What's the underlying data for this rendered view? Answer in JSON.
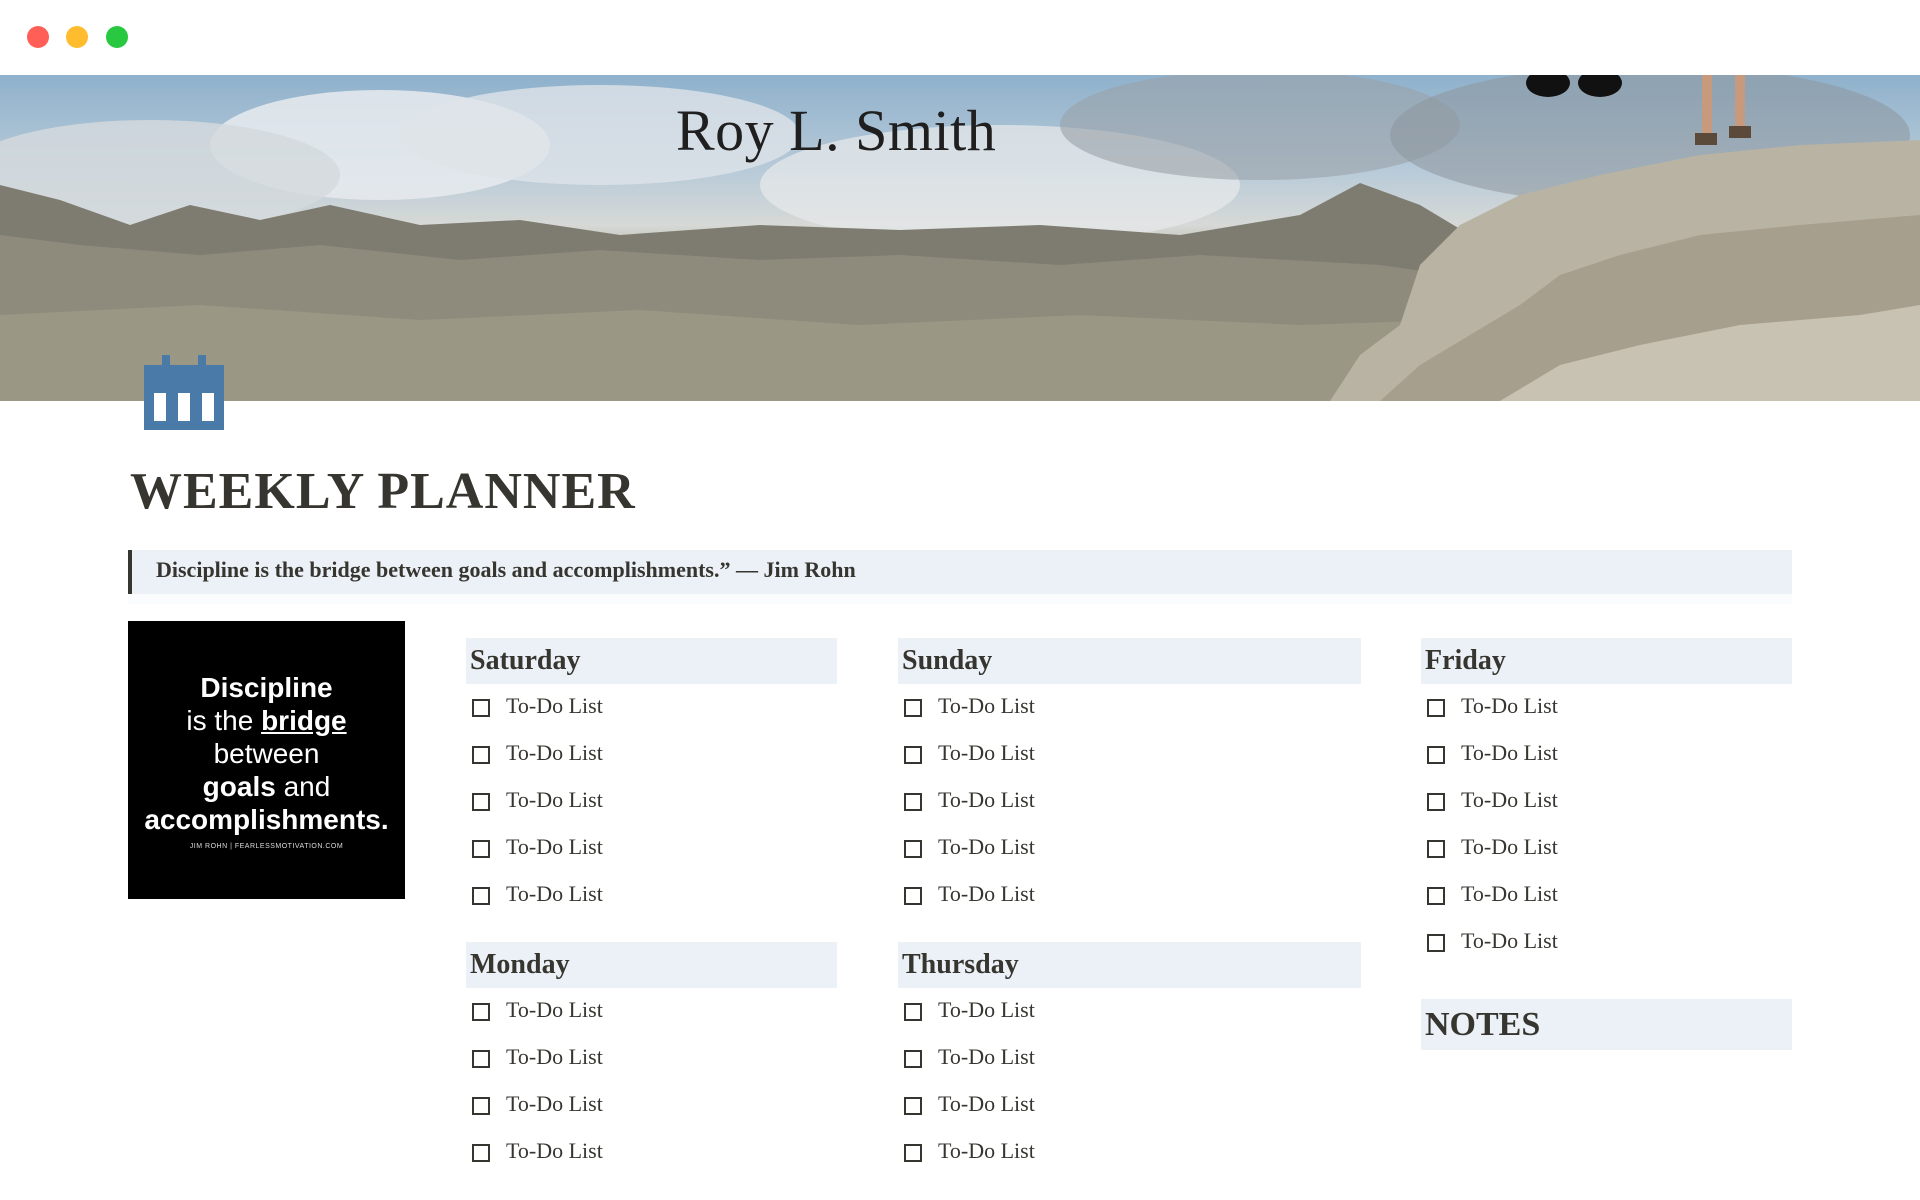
{
  "cover": {
    "caption": "Roy L. Smith"
  },
  "page": {
    "icon": "calendar-icon",
    "icon_color": "#4a7aa7",
    "title": "WEEKLY PLANNER",
    "quote": "Discipline is the bridge between goals and accomplishments.” — Jim Rohn"
  },
  "quote_image": {
    "line1": "Discipline",
    "line2_pre": "is the ",
    "line2_word": "bridge",
    "line3": "between",
    "line4_word": "goals",
    "line4_post": " and",
    "line5": "accomplishments.",
    "credit": "JIM ROHN | FEARLESSMOTIVATION.COM"
  },
  "days": {
    "saturday": {
      "title": "Saturday",
      "items": [
        "To-Do List",
        "To-Do List",
        "To-Do List",
        "To-Do List",
        "To-Do List"
      ]
    },
    "sunday": {
      "title": "Sunday",
      "items": [
        "To-Do List",
        "To-Do List",
        "To-Do List",
        "To-Do List",
        "To-Do List"
      ]
    },
    "friday": {
      "title": "Friday",
      "items": [
        "To-Do List",
        "To-Do List",
        "To-Do List",
        "To-Do List",
        "To-Do List",
        "To-Do List"
      ]
    },
    "monday": {
      "title": "Monday",
      "items": [
        "To-Do List",
        "To-Do List",
        "To-Do List",
        "To-Do List"
      ]
    },
    "thursday": {
      "title": "Thursday",
      "items": [
        "To-Do List",
        "To-Do List",
        "To-Do List",
        "To-Do List"
      ]
    }
  },
  "notes": {
    "title": "NOTES"
  },
  "colors": {
    "heading_bg": "#ebf1f7",
    "text": "#37352f"
  }
}
